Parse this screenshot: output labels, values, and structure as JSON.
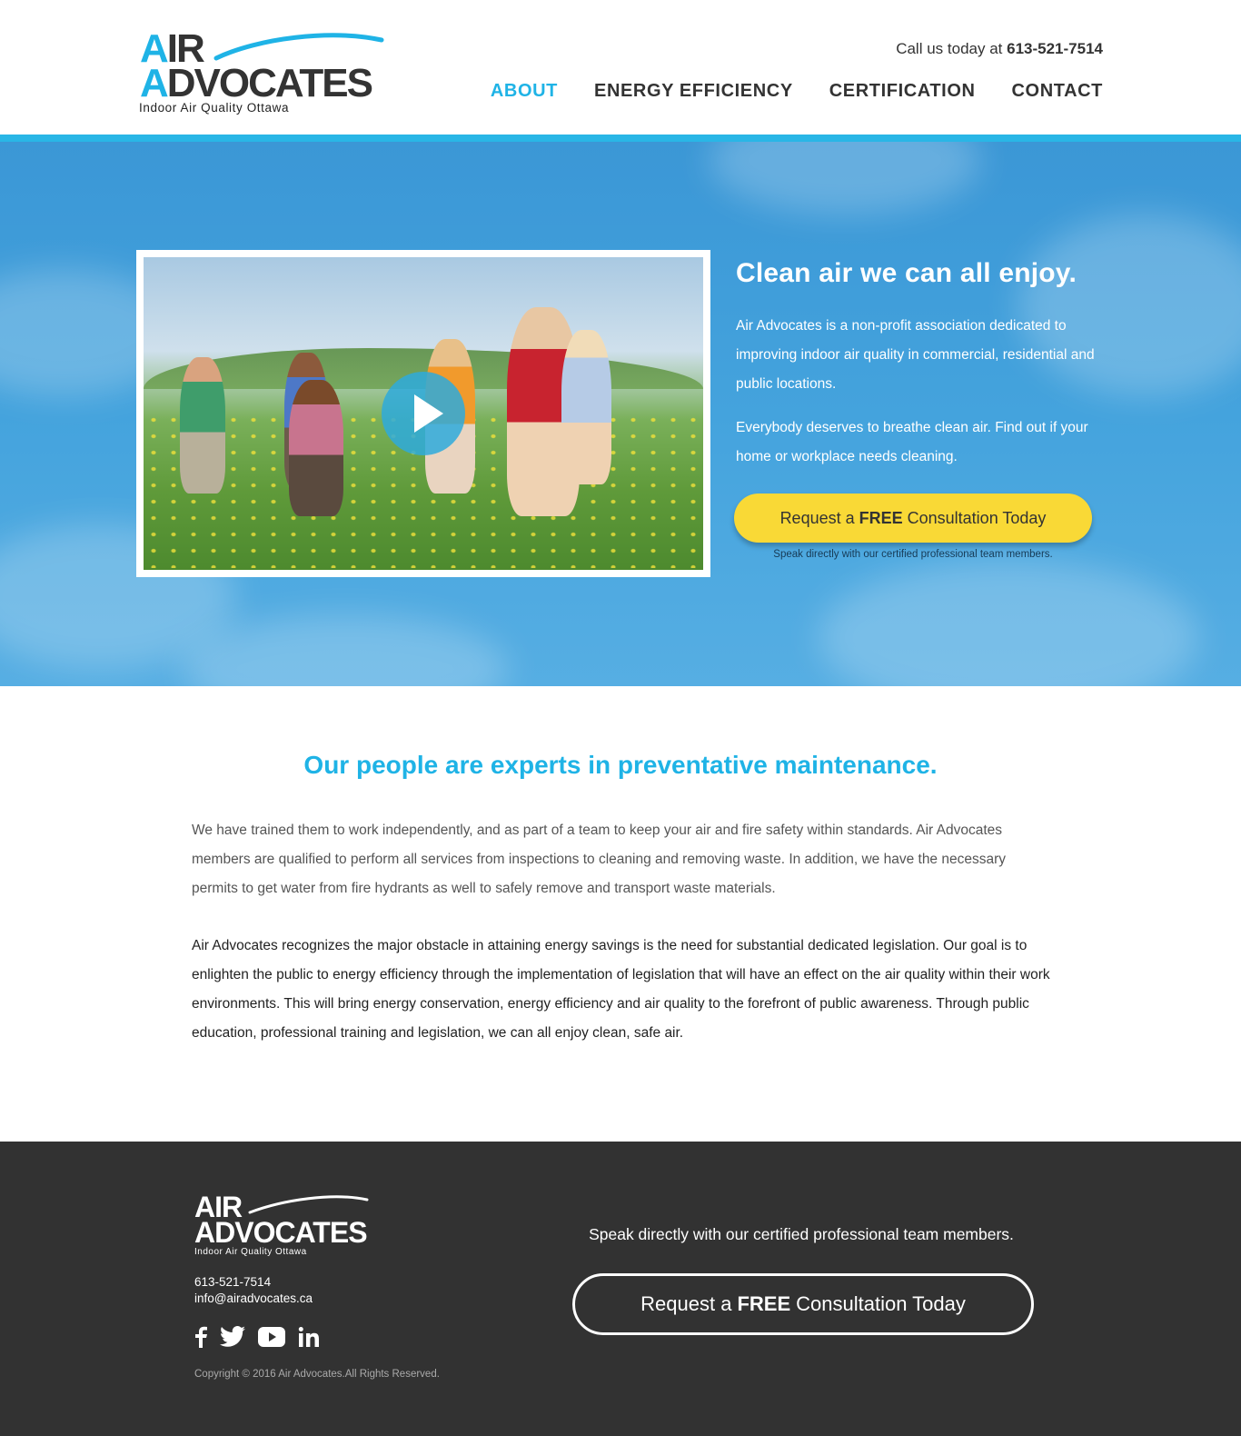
{
  "brand": {
    "logo_line1_accent": "A",
    "logo_line1_rest": "IR",
    "logo_line2_accent": "A",
    "logo_line2_rest": "DVOCATES",
    "tagline": "Indoor Air Quality Ottawa",
    "accent_color": "#1fb3e6"
  },
  "header": {
    "call_prefix": "Call us today at",
    "phone": "613-521-7514"
  },
  "nav": [
    {
      "label": "ABOUT",
      "active": true
    },
    {
      "label": "ENERGY EFFICIENCY",
      "active": false
    },
    {
      "label": "CERTIFICATION",
      "active": false
    },
    {
      "label": "CONTACT",
      "active": false
    }
  ],
  "hero": {
    "title": "Clean air we can all enjoy.",
    "paragraph1": "Air Advocates is a non-profit association dedicated to improving indoor air quality in commercial, residential and public locations.",
    "paragraph2": "Everybody deserves to breathe clean air. Find out if your home or workplace needs cleaning.",
    "cta_pre": "Request a",
    "cta_bold": "FREE",
    "cta_post": "Consultation Today",
    "cta_note": "Speak directly with our certified professional team members.",
    "play_icon": "play-icon"
  },
  "content": {
    "heading": "Our people are experts in preventative maintenance.",
    "paragraph1": "We have trained them to work independently, and as part of a team to keep your air and fire safety within standards. Air Advocates members are qualified to perform all services from inspections to cleaning and removing waste. In addition, we have the necessary permits to get water from fire hydrants as well to safely remove and transport waste materials.",
    "paragraph2": "Air Advocates recognizes the major obstacle in attaining energy savings is the need for substantial dedicated legislation. Our goal is to enlighten the public to energy efficiency through the implementation of legislation that will have an effect on the air quality within their work environments. This will bring energy conservation, energy efficiency and air quality to the forefront of public awareness. Through public education, professional training and legislation, we can all enjoy clean, safe air."
  },
  "footer": {
    "logo_line1": "AIR",
    "logo_line2": "ADVOCATES",
    "tagline": "Indoor Air Quality Ottawa",
    "phone": "613-521-7514",
    "email": "info@airadvocates.ca",
    "social": [
      "facebook-icon",
      "twitter-icon",
      "youtube-icon",
      "linkedin-icon"
    ],
    "copyright": "Copyright © 2016 Air Advocates.All Rights Reserved.",
    "note": "Speak directly with our certified professional team members.",
    "cta_pre": "Request a",
    "cta_bold": "FREE",
    "cta_post": "Consultation Today"
  }
}
